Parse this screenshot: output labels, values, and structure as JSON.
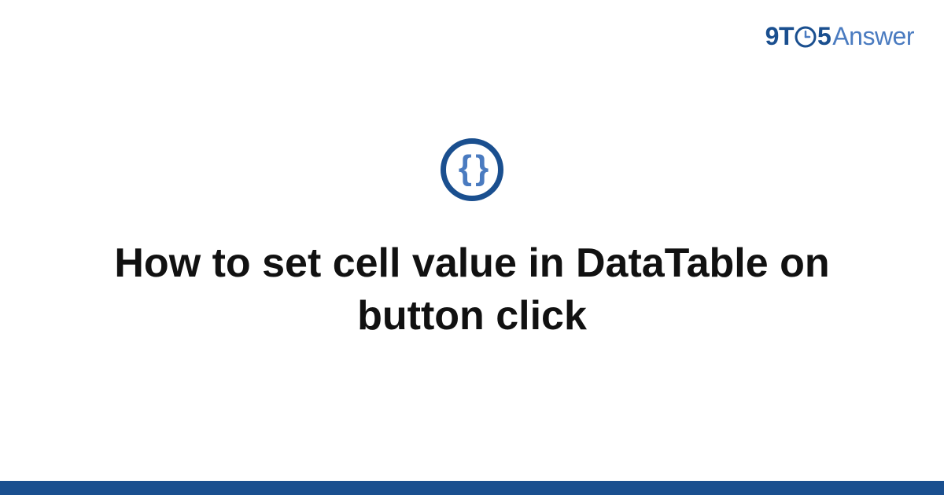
{
  "brand": {
    "part1": "9T",
    "part2": "5",
    "part3": "Answer"
  },
  "topic_icon": {
    "glyph": "{ }",
    "name": "code-braces-icon"
  },
  "title": "How to set cell value in DataTable on button click",
  "colors": {
    "brand_dark": "#1a4f8f",
    "brand_light": "#4a7bc0"
  }
}
